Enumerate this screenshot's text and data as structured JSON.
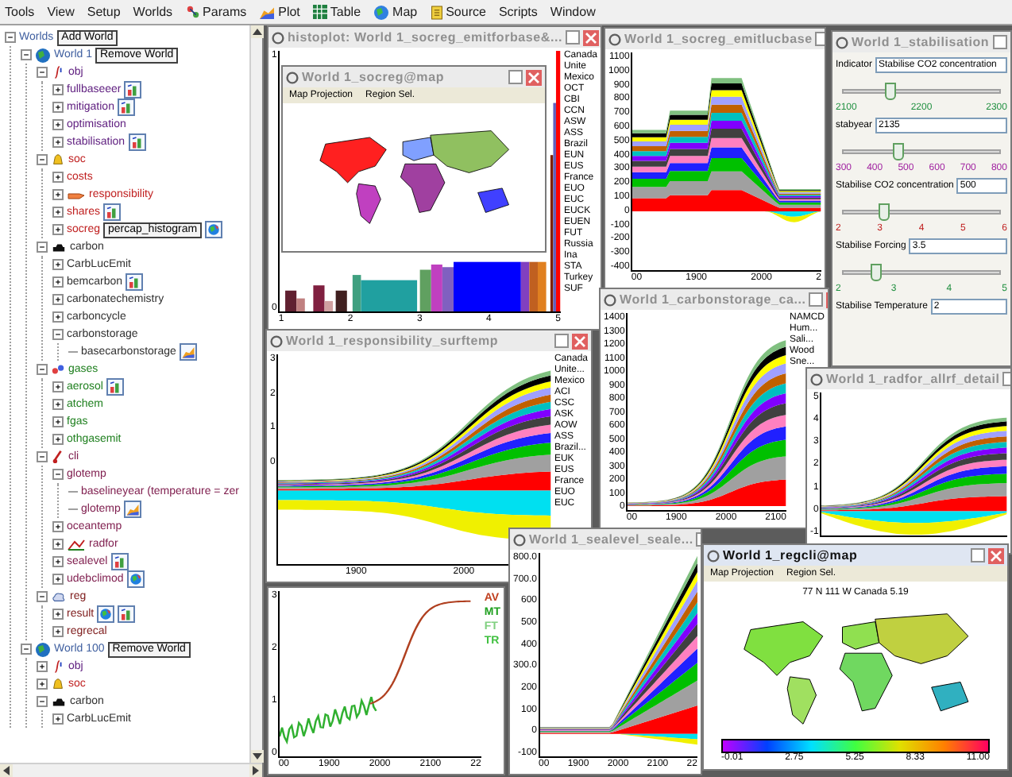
{
  "menu": [
    {
      "label": "Tools",
      "kind": "plain"
    },
    {
      "label": "View",
      "kind": "plain"
    },
    {
      "label": "Setup",
      "kind": "plain"
    },
    {
      "label": "Worlds",
      "kind": "plain"
    },
    {
      "label": "Params",
      "kind": "params"
    },
    {
      "label": "Plot",
      "kind": "plot"
    },
    {
      "label": "Table",
      "kind": "table"
    },
    {
      "label": "Map",
      "kind": "map"
    },
    {
      "label": "Source",
      "kind": "source"
    },
    {
      "label": "Scripts",
      "kind": "plain"
    },
    {
      "label": "Window",
      "kind": "plain"
    }
  ],
  "tree": [
    {
      "label": "Worlds",
      "expanded": true,
      "button": "Add World",
      "children": [
        {
          "label": "World 1",
          "kind": "world",
          "expanded": true,
          "button": "Remove World",
          "children": [
            {
              "label": "obj",
              "kind": "obj",
              "expanded": true,
              "children": [
                {
                  "label": "fullbaseeer",
                  "expanded": false,
                  "actions": [
                    {
                      "kind": "chart"
                    }
                  ]
                },
                {
                  "label": "mitigation",
                  "expanded": false,
                  "actions": [
                    {
                      "kind": "chart"
                    }
                  ]
                },
                {
                  "label": "optimisation",
                  "expanded": false
                },
                {
                  "label": "stabilisation",
                  "expanded": false,
                  "actions": [
                    {
                      "kind": "chart"
                    }
                  ]
                }
              ]
            },
            {
              "label": "soc",
              "kind": "soc",
              "expanded": true,
              "children": [
                {
                  "label": "costs",
                  "expanded": false
                },
                {
                  "label": "responsibility",
                  "kind": "hand",
                  "expanded": false
                },
                {
                  "label": "shares",
                  "expanded": false,
                  "actions": [
                    {
                      "kind": "chart"
                    }
                  ]
                },
                {
                  "label": "socreg",
                  "expanded": false,
                  "button": "percap_histogram",
                  "actions": [
                    {
                      "kind": "map"
                    }
                  ]
                }
              ]
            },
            {
              "label": "carbon",
              "kind": "carbon",
              "expanded": true,
              "children": [
                {
                  "label": "CarbLucEmit",
                  "expanded": false
                },
                {
                  "label": "bemcarbon",
                  "expanded": false,
                  "actions": [
                    {
                      "kind": "chart"
                    }
                  ]
                },
                {
                  "label": "carbonatechemistry",
                  "expanded": false
                },
                {
                  "label": "carboncycle",
                  "expanded": false
                },
                {
                  "label": "carbonstorage",
                  "expanded": true,
                  "children": [
                    {
                      "label": "basecarbonstorage",
                      "actions": [
                        {
                          "kind": "area"
                        }
                      ]
                    }
                  ]
                }
              ]
            },
            {
              "label": "gases",
              "kind": "gases",
              "expanded": true,
              "children": [
                {
                  "label": "aerosol",
                  "expanded": false,
                  "actions": [
                    {
                      "kind": "chart"
                    }
                  ]
                },
                {
                  "label": "atchem",
                  "expanded": false
                },
                {
                  "label": "fgas",
                  "expanded": false
                },
                {
                  "label": "othgasemit",
                  "expanded": false
                }
              ]
            },
            {
              "label": "cli",
              "kind": "cli",
              "expanded": true,
              "children": [
                {
                  "label": "glotemp",
                  "expanded": true,
                  "children": [
                    {
                      "label": "baselineyear (temperature = zer"
                    },
                    {
                      "label": "glotemp",
                      "actions": [
                        {
                          "kind": "area"
                        }
                      ]
                    }
                  ]
                },
                {
                  "label": "oceantemp",
                  "expanded": false
                },
                {
                  "label": "radfor",
                  "kind": "rad",
                  "expanded": false
                },
                {
                  "label": "sealevel",
                  "expanded": false,
                  "actions": [
                    {
                      "kind": "chart"
                    }
                  ]
                },
                {
                  "label": "udebclimod",
                  "expanded": false,
                  "actions": [
                    {
                      "kind": "map"
                    }
                  ]
                }
              ]
            },
            {
              "label": "reg",
              "kind": "reg",
              "expanded": true,
              "children": [
                {
                  "label": "result",
                  "expanded": false,
                  "actions": [
                    {
                      "kind": "map"
                    },
                    {
                      "kind": "chart"
                    }
                  ]
                },
                {
                  "label": "regrecal",
                  "expanded": false
                }
              ]
            }
          ]
        },
        {
          "label": "World 100",
          "kind": "world",
          "expanded": true,
          "button": "Remove World",
          "children": [
            {
              "label": "obj",
              "kind": "obj",
              "expanded": false
            },
            {
              "label": "soc",
              "kind": "soc",
              "expanded": false
            },
            {
              "label": "carbon",
              "kind": "carbon",
              "expanded": true,
              "children": [
                {
                  "label": "CarbLucEmit",
                  "expanded": false
                }
              ]
            }
          ]
        }
      ]
    }
  ],
  "windows": [
    {
      "title": "histoplot: World 1_socreg_emitforbase&...",
      "active": false,
      "kind": "histogram",
      "yticks": [
        "1",
        "0"
      ],
      "xticks": [
        "1",
        "2",
        "3",
        "4",
        "5"
      ],
      "legend": [
        "Canada",
        "Unite",
        "Mexico",
        "OCT",
        "CBI",
        "CCN",
        "ASW",
        "ASS",
        "Brazil",
        "EUN",
        "EUS",
        "France",
        "EUO",
        "EUC",
        "EUCK",
        "EUEN",
        "FUT",
        "Russia",
        "Ina",
        "STA",
        "Turkey",
        "SUF"
      ]
    },
    {
      "title": "World 1_socreg@map",
      "active": false,
      "kind": "map",
      "menu": [
        "Map Projection",
        "Region Sel."
      ]
    },
    {
      "title": "World 1_socreg_emitlucbase",
      "active": false,
      "kind": "stack",
      "yticks": [
        "1100",
        "1000",
        "900",
        "800",
        "700",
        "600",
        "500",
        "400",
        "300",
        "200",
        "100",
        "0",
        "-100",
        "-200",
        "-300",
        "-400"
      ],
      "xticks": [
        "00",
        "1900",
        "2000",
        "2"
      ]
    },
    {
      "title": "World 1_stabilisation",
      "active": false,
      "kind": "controls",
      "controls": [
        {
          "kind": "field",
          "label": "Indicator",
          "value": "Stabilise CO2 concentration"
        },
        {
          "kind": "slider",
          "level": 0.3,
          "ticks": [
            "2100",
            "2200",
            "2300"
          ]
        },
        {
          "kind": "field",
          "label": "stabyear",
          "value": "2135"
        },
        {
          "kind": "slider",
          "level": 0.35,
          "ticks": [
            "300",
            "400",
            "500",
            "600",
            "700",
            "800"
          ]
        },
        {
          "kind": "field",
          "label": "Stabilise CO2 concentration",
          "value": "500"
        },
        {
          "kind": "slider",
          "level": 0.25,
          "ticks": [
            "2",
            "3",
            "4",
            "5",
            "6"
          ]
        },
        {
          "kind": "field",
          "label": "Stabilise Forcing",
          "value": "3.5"
        },
        {
          "kind": "slider",
          "level": 0.2,
          "ticks": [
            "2",
            "3",
            "4",
            "5"
          ]
        },
        {
          "kind": "field",
          "label": "Stabilise Temperature",
          "value": "2"
        }
      ]
    },
    {
      "title": "World 1_responsibility_surftemp",
      "active": false,
      "kind": "stack",
      "yticks": [
        "3",
        "2",
        "1",
        "0"
      ],
      "xticks": [
        "1900",
        "2000"
      ],
      "legend": [
        "Canada",
        "Unite...",
        "Mexico",
        "ACI",
        "CSC",
        "ASK",
        "AOW",
        "ASS",
        "Brazil...",
        "EUK",
        "EUS",
        "France",
        "EUO",
        "EUC"
      ]
    },
    {
      "kind": "line",
      "yticks": [
        "3",
        "2",
        "1",
        "0"
      ],
      "xticks": [
        "00",
        "1900",
        "2000",
        "2100",
        "22"
      ],
      "legend": [
        {
          "label": "AV",
          "color": "#c04020"
        },
        {
          "label": "MT",
          "color": "#20a020"
        },
        {
          "label": "FT",
          "color": "#80d080"
        },
        {
          "label": "TR",
          "color": "#40c040"
        }
      ]
    },
    {
      "title": "World 1_carbonstorage_ca...",
      "active": false,
      "kind": "stack",
      "yticks": [
        "1400",
        "1300",
        "1200",
        "1100",
        "1000",
        "900",
        "800",
        "700",
        "600",
        "500",
        "400",
        "300",
        "200",
        "100",
        "0"
      ],
      "xticks": [
        "00",
        "1900",
        "2000",
        "2100"
      ],
      "legend": [
        "NAMCD",
        "Hum...",
        "Sali...",
        "Wood",
        "Sne..."
      ]
    },
    {
      "title": "World 1_radfor_allrf_detail",
      "active": false,
      "kind": "stack",
      "yticks": [
        "5",
        "4",
        "3",
        "2",
        "1",
        "0",
        "-1"
      ]
    },
    {
      "title": "World 1_sealevel_seale...",
      "active": false,
      "kind": "stack",
      "yticks": [
        "800.0",
        "700.0",
        "600",
        "500",
        "400",
        "300.0",
        "200",
        "100",
        "0",
        "-100"
      ],
      "xticks": [
        "00",
        "1900",
        "2000",
        "2100",
        "22"
      ]
    },
    {
      "title": "World 1_regcli@map",
      "active": true,
      "kind": "map",
      "menu": [
        "Map Projection",
        "Region Sel."
      ],
      "caption": "77 N 111 W Canada 5.19",
      "colorbar_ticks": [
        "-0.01",
        "2.75",
        "5.25",
        "8.33",
        "11.00"
      ]
    }
  ]
}
